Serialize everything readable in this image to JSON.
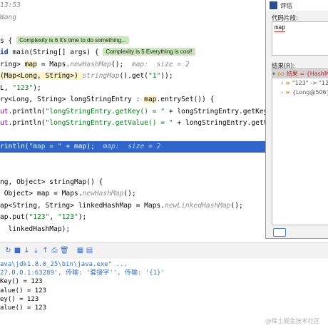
{
  "editor": {
    "lines": [
      {
        "segments": [
          {
            "t": "13:53",
            "c": "cmt"
          }
        ]
      },
      {
        "segments": [
          {
            "t": "Wang",
            "c": "cmt"
          }
        ]
      },
      {
        "segments": [
          {
            "t": ""
          }
        ]
      },
      {
        "segments": [
          {
            "t": "s { "
          },
          {
            "t": "Complexity is 6 It's time to do something...",
            "c": "badge"
          }
        ]
      },
      {
        "segments": [
          {
            "t": "id",
            "c": "kw"
          },
          {
            "t": " main(String[] args) { "
          },
          {
            "t": "Complexity is 5 Everything is cool!",
            "c": "badge"
          }
        ]
      },
      {
        "segments": [
          {
            "t": "ring> "
          },
          {
            "t": "map",
            "c": "sel-bg"
          },
          {
            "t": " = Maps."
          },
          {
            "t": "newHashMap",
            "c": "hint"
          },
          {
            "t": "();  "
          },
          {
            "t": "map:  size = 2",
            "c": "hint"
          }
        ]
      },
      {
        "segments": [
          {
            "t": "(Map<Long, String>) ",
            "c": "sel-bg"
          },
          {
            "t": "stringMap",
            "c": "hint"
          },
          {
            "t": "().get("
          },
          {
            "t": "\"1\"",
            "c": "str"
          },
          {
            "t": "));"
          }
        ]
      },
      {
        "segments": [
          {
            "t": "L, "
          },
          {
            "t": "\"123\"",
            "c": "str"
          },
          {
            "t": ");"
          }
        ]
      },
      {
        "segments": [
          {
            "t": "ry<Long, String> longStringEntry : "
          },
          {
            "t": "map",
            "c": "sel-bg"
          },
          {
            "t": ".entrySet()) {"
          }
        ]
      },
      {
        "segments": [
          {
            "t": "ut",
            "c": "fld"
          },
          {
            "t": ".println("
          },
          {
            "t": "\"longStringEntry.getKey() = \"",
            "c": "str"
          },
          {
            "t": " + longStringEntry.getKey());"
          }
        ]
      },
      {
        "segments": [
          {
            "t": "ut",
            "c": "fld"
          },
          {
            "t": ".println("
          },
          {
            "t": "\"longStringEntry.getValue() = \"",
            "c": "str"
          },
          {
            "t": " + longStringEntry.getValue());"
          }
        ]
      },
      {
        "segments": [
          {
            "t": ""
          }
        ]
      },
      {
        "hl": true,
        "segments": [
          {
            "t": "rintln("
          },
          {
            "t": "\"map = \"",
            "c": "str"
          },
          {
            "t": " + map);  "
          },
          {
            "t": "map:  size = 2",
            "c": "hint"
          }
        ]
      },
      {
        "segments": [
          {
            "t": ""
          }
        ]
      },
      {
        "segments": [
          {
            "t": ""
          }
        ]
      },
      {
        "segments": [
          {
            "t": "ng, Object> stringMap() {"
          }
        ]
      },
      {
        "segments": [
          {
            "t": " Object> map = Maps."
          },
          {
            "t": "newHashMap",
            "c": "hint"
          },
          {
            "t": "();"
          }
        ]
      },
      {
        "segments": [
          {
            "t": "ap<String, String> linkedHashMap = Maps."
          },
          {
            "t": "newLinkedHashMap",
            "c": "hint"
          },
          {
            "t": "();"
          }
        ]
      },
      {
        "segments": [
          {
            "t": "ap.put("
          },
          {
            "t": "\"123\"",
            "c": "str"
          },
          {
            "t": ", "
          },
          {
            "t": "\"123\"",
            "c": "str"
          },
          {
            "t": ");"
          }
        ]
      },
      {
        "segments": [
          {
            "t": "  linkedHashMap);"
          }
        ]
      }
    ]
  },
  "console": {
    "lines": [
      {
        "t": "ava\\jdk1.8.0_25\\bin\\java.exe\" ...",
        "color": "#3a6fc8"
      },
      {
        "t": "27.0.0.1:63289', 传输: '套接字'', 传输: '{1}'",
        "color": "#3a6fc8"
      },
      {
        "t": "Key() = 123",
        "color": "#080808"
      },
      {
        "t": "alue() = 123",
        "color": "#080808"
      },
      {
        "t": "ey() = 123",
        "color": "#080808"
      },
      {
        "t": "alue() = 123",
        "color": "#080808"
      }
    ]
  },
  "dialog": {
    "title": "评估",
    "code_label": "代码片段:",
    "code_value": "map",
    "result_label": "结果(R):",
    "tree": [
      {
        "arrow": "▾",
        "icon": "oo",
        "label": "结果 = {HashMap",
        "selected": true
      },
      {
        "arrow": "›",
        "icon": "≡",
        "label": "\"123\" -> \"12",
        "selected": false
      },
      {
        "arrow": "›",
        "icon": "≡",
        "label": "{Long@506}",
        "selected": false
      }
    ]
  },
  "toolbar_icons": [
    "rerun-icon",
    "stop-icon",
    "down-icon",
    "down-alt-icon",
    "up-icon",
    "print-icon",
    "delete-icon",
    "layout-icon",
    "pin-icon"
  ],
  "watermark": "@稀土掘金技术社区"
}
